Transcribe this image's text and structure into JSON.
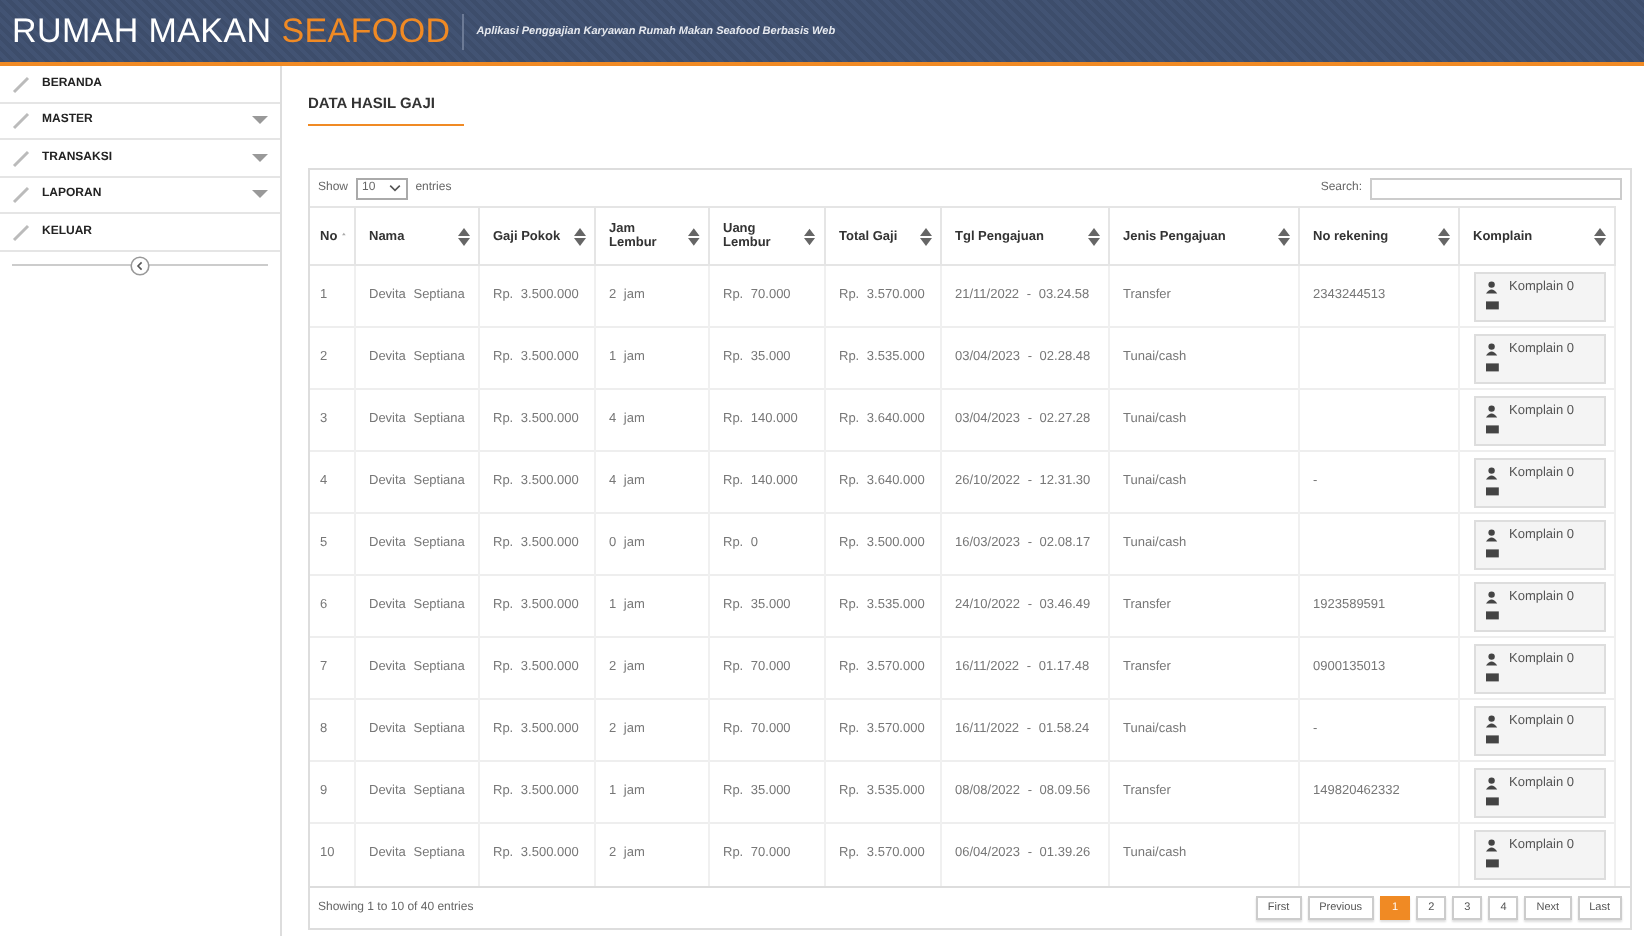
{
  "header": {
    "brand": "RUMAH MAKAN",
    "brand_highlight": "SEAFOOD",
    "subtitle": "Aplikasi Penggajian Karyawan Rumah Makan Seafood Berbasis Web"
  },
  "sidebar": {
    "items": [
      {
        "label": "BERANDA",
        "has_submenu": false
      },
      {
        "label": "MASTER",
        "has_submenu": true
      },
      {
        "label": "TRANSAKSI",
        "has_submenu": true
      },
      {
        "label": "LAPORAN",
        "has_submenu": true
      },
      {
        "label": "KELUAR",
        "has_submenu": false
      }
    ]
  },
  "page_title": "DATA HASIL GAJI",
  "table": {
    "show_label": "Show",
    "length": "10",
    "entries_label": "entries",
    "search_label": "Search:",
    "columns": [
      "No",
      "Nama",
      "Gaji Pokok",
      "Jam Lembur",
      "Uang Lembur",
      "Total Gaji",
      "Tgl Pengajuan",
      "Jenis Pengajuan",
      "No rekening",
      "Komplain"
    ],
    "rows": [
      [
        "1",
        "Devita Septiana",
        "Rp. 3.500.000",
        "2 jam",
        "Rp. 70.000",
        "Rp. 3.570.000",
        "21/11/2022 - 03.24.58",
        "Transfer",
        "2343244513",
        "Komplain 0"
      ],
      [
        "2",
        "Devita Septiana",
        "Rp. 3.500.000",
        "1 jam",
        "Rp. 35.000",
        "Rp. 3.535.000",
        "03/04/2023 - 02.28.48",
        "Tunai/cash",
        "",
        "Komplain 0"
      ],
      [
        "3",
        "Devita Septiana",
        "Rp. 3.500.000",
        "4 jam",
        "Rp. 140.000",
        "Rp. 3.640.000",
        "03/04/2023 - 02.27.28",
        "Tunai/cash",
        "",
        "Komplain 0"
      ],
      [
        "4",
        "Devita Septiana",
        "Rp. 3.500.000",
        "4 jam",
        "Rp. 140.000",
        "Rp. 3.640.000",
        "26/10/2022 - 12.31.30",
        "Tunai/cash",
        "-",
        "Komplain 0"
      ],
      [
        "5",
        "Devita Septiana",
        "Rp. 3.500.000",
        "0 jam",
        "Rp. 0",
        "Rp. 3.500.000",
        "16/03/2023 - 02.08.17",
        "Tunai/cash",
        "",
        "Komplain 0"
      ],
      [
        "6",
        "Devita Septiana",
        "Rp. 3.500.000",
        "1 jam",
        "Rp. 35.000",
        "Rp. 3.535.000",
        "24/10/2022 - 03.46.49",
        "Transfer",
        "1923589591",
        "Komplain 0"
      ],
      [
        "7",
        "Devita Septiana",
        "Rp. 3.500.000",
        "2 jam",
        "Rp. 70.000",
        "Rp. 3.570.000",
        "16/11/2022 - 01.17.48",
        "Transfer",
        "0900135013",
        "Komplain 0"
      ],
      [
        "8",
        "Devita Septiana",
        "Rp. 3.500.000",
        "2 jam",
        "Rp. 70.000",
        "Rp. 3.570.000",
        "16/11/2022 - 01.58.24",
        "Tunai/cash",
        "-",
        "Komplain 0"
      ],
      [
        "9",
        "Devita Septiana",
        "Rp. 3.500.000",
        "1 jam",
        "Rp. 35.000",
        "Rp. 3.535.000",
        "08/08/2022 - 08.09.56",
        "Transfer",
        "149820462332",
        "Komplain 0"
      ],
      [
        "10",
        "Devita Septiana",
        "Rp. 3.500.000",
        "2 jam",
        "Rp. 70.000",
        "Rp. 3.570.000",
        "06/04/2023 - 01.39.26",
        "Tunai/cash",
        "",
        "Komplain 0"
      ]
    ],
    "info": "Showing 1 to 10 of 40 entries",
    "pagination": [
      {
        "label": "First",
        "selected": false
      },
      {
        "label": "Previous",
        "selected": false
      },
      {
        "label": "1",
        "selected": true
      },
      {
        "label": "2",
        "selected": false
      },
      {
        "label": "3",
        "selected": false
      },
      {
        "label": "4",
        "selected": false
      },
      {
        "label": "Next",
        "selected": false
      },
      {
        "label": "Last",
        "selected": false
      }
    ]
  }
}
